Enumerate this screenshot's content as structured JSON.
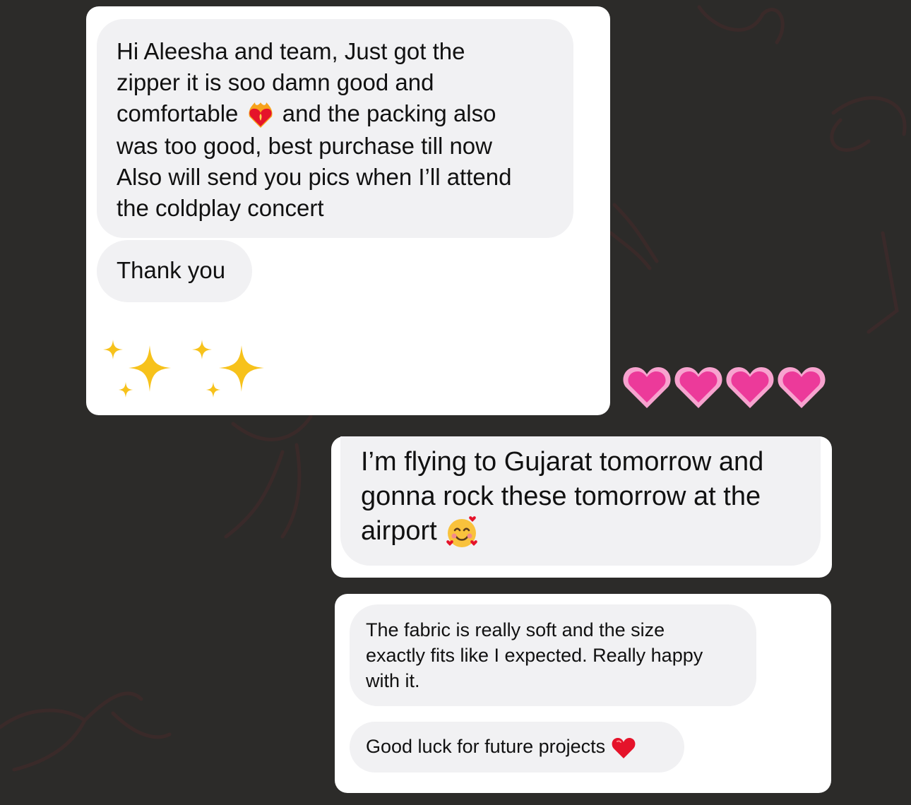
{
  "messages": {
    "card1": {
      "bubble1_line1": "Hi Aleesha and team, Just got the",
      "bubble1_line2": "zipper it is soo damn good and",
      "bubble1_line3a": "comfortable",
      "bubble1_line3b": "and the packing also",
      "bubble1_line4": "was too good, best purchase till now",
      "bubble1_line5": "Also will send you pics when I’ll attend",
      "bubble1_line6": "the coldplay concert",
      "bubble2": "Thank you",
      "emoji_flaming_heart": "heart-on-fire-icon",
      "emoji_sparkles": "sparkles-icon"
    },
    "hearts": {
      "emoji": "growing-heart-icon",
      "count": 4
    },
    "card2": {
      "line1": "I’m flying to Gujarat tomorrow and",
      "line2": "gonna rock these tomorrow at the",
      "line3": "airport",
      "emoji": "smiling-face-with-hearts-icon"
    },
    "card3": {
      "bubble1_line1": "The fabric is really soft and the size",
      "bubble1_line2": "exactly fits like I expected. Really happy",
      "bubble1_line3": "with it.",
      "bubble2": "Good luck for future projects",
      "emoji": "red-heart-icon"
    }
  },
  "colors": {
    "background": "#2c2b29",
    "card": "#ffffff",
    "bubble": "#f1f1f3",
    "text": "#111111",
    "heart_pink": "#ec3a9a",
    "heart_red": "#e5132a",
    "sparkle": "#f7c21b"
  }
}
